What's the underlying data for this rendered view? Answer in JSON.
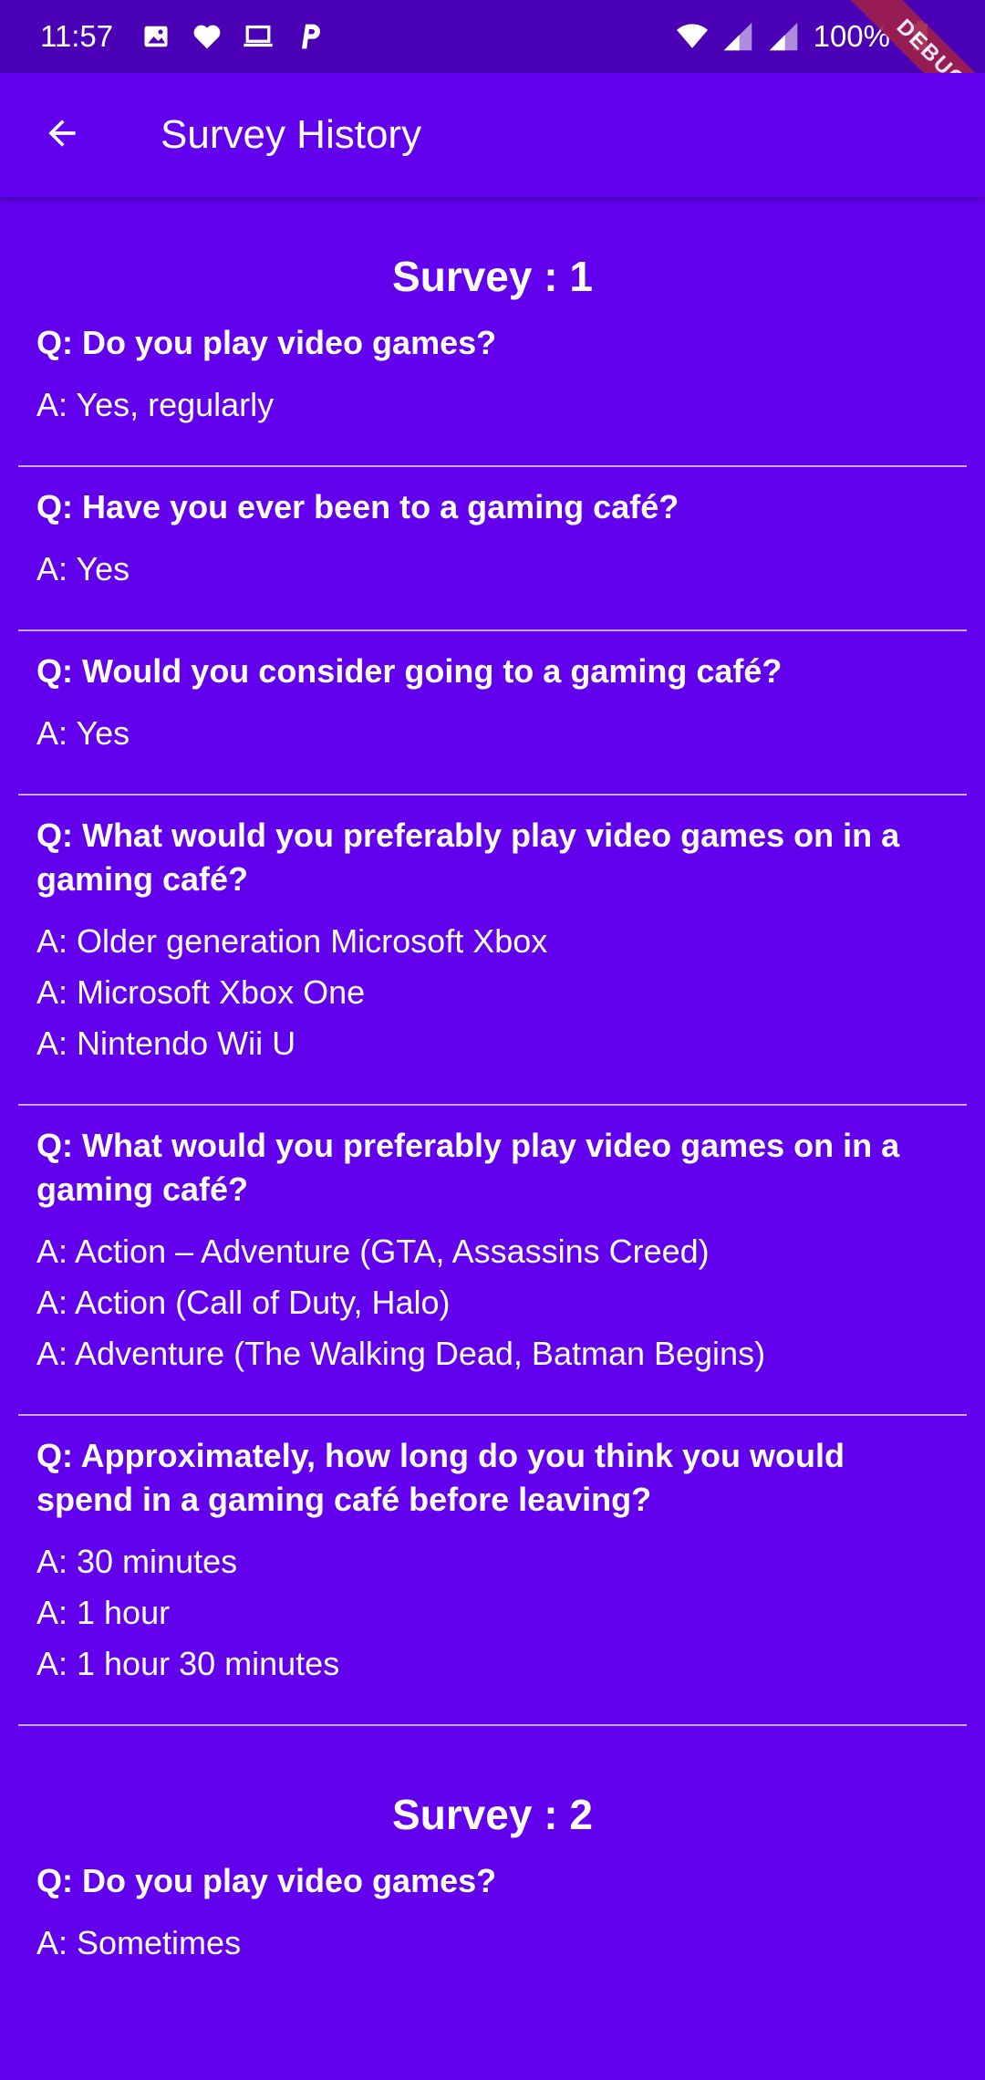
{
  "status_bar": {
    "time": "11:57",
    "battery": "100%",
    "left_icons": [
      "image-icon",
      "heart-icon",
      "laptop-icon",
      "p-app-icon"
    ],
    "right_icons": [
      "wifi-icon",
      "signal-icon",
      "signal-icon",
      "battery-icon"
    ]
  },
  "debug_banner": "DEBUG",
  "app_bar": {
    "title": "Survey History",
    "back_icon": "arrow-back-icon"
  },
  "surveys": [
    {
      "title": "Survey : 1",
      "items": [
        {
          "question": "Q: Do you play video games?",
          "answers": [
            "A: Yes, regularly"
          ]
        },
        {
          "question": "Q: Have you ever been to a gaming café?",
          "answers": [
            "A: Yes"
          ]
        },
        {
          "question": "Q: Would you consider going to a gaming café?",
          "answers": [
            "A: Yes"
          ]
        },
        {
          "question": "Q: What would you preferably play video games on in a gaming café?",
          "answers": [
            "A: Older generation Microsoft Xbox",
            "A: Microsoft Xbox One",
            "A: Nintendo Wii U"
          ]
        },
        {
          "question": "Q: What would you preferably play video games on in a gaming café?",
          "answers": [
            "A: Action – Adventure (GTA, Assassins Creed)",
            "A: Action (Call of Duty, Halo)",
            "A: Adventure (The Walking Dead, Batman Begins)"
          ]
        },
        {
          "question": "Q: Approximately, how long do you think you would spend in a gaming café before leaving?",
          "answers": [
            "A: 30 minutes",
            "A: 1 hour",
            "A: 1 hour 30 minutes"
          ]
        }
      ]
    },
    {
      "title": "Survey : 2",
      "items": [
        {
          "question": "Q: Do you play video games?",
          "answers": [
            "A: Sometimes"
          ]
        }
      ]
    }
  ]
}
